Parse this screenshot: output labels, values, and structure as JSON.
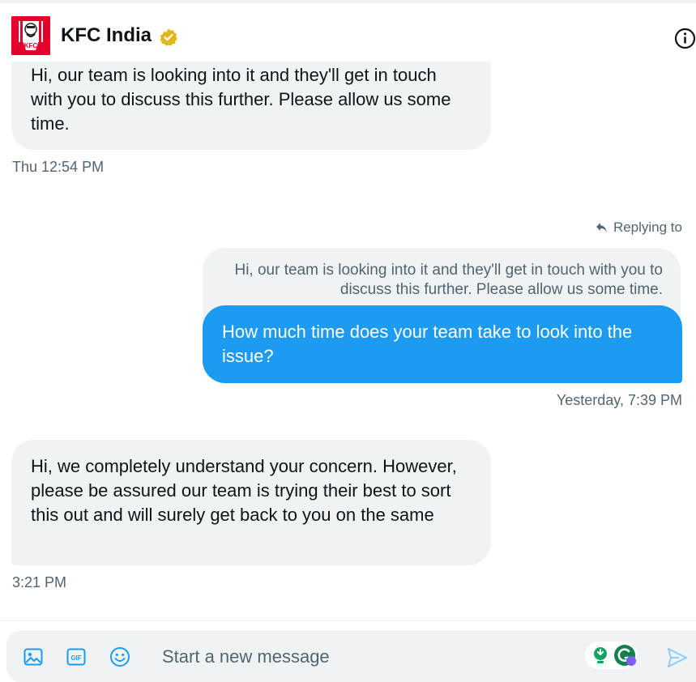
{
  "header": {
    "title": "KFC India",
    "avatar_text": "KFC",
    "icons": {
      "verified": "verified-badge-icon",
      "info": "info-icon"
    }
  },
  "messages": [
    {
      "direction": "incoming",
      "text": "Hi, our team is looking into it and they'll get in touch with you to discuss this further. Please allow us some time.",
      "timestamp": "Thu 12:54 PM"
    },
    {
      "direction": "outgoing",
      "replying_label": "Replying to",
      "quoted_text": "Hi, our team is looking into it and they'll get in touch with you to discuss this further. Please allow us some time.",
      "text": "How much time does your team take to look into the issue?",
      "timestamp": "Yesterday, 7:39 PM"
    },
    {
      "direction": "incoming",
      "text": "Hi, we completely understand your concern. However, please be assured our team is trying their best to sort this out and will surely get back to you on the same",
      "timestamp": "3:21 PM"
    }
  ],
  "composer": {
    "placeholder": "Start a new message",
    "icons": [
      "image-icon",
      "gif-icon",
      "emoji-icon",
      "extension-icon",
      "grammarly-icon",
      "send-icon"
    ]
  },
  "colors": {
    "accent": "#1d9bf0",
    "bubble_in": "#eff3f4",
    "muted_text": "#536471",
    "verified_gold": "#e2b719",
    "kfc_red": "#e4002b"
  }
}
